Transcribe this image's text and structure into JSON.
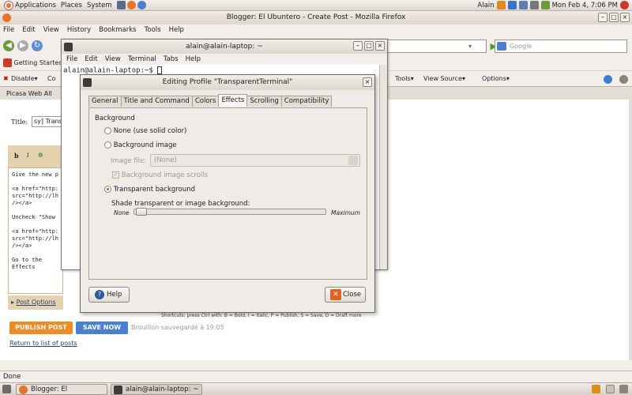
{
  "panel": {
    "applications": "Applications",
    "places": "Places",
    "system": "System",
    "user": "Alain",
    "clock": "Mon Feb  4,  7:06 PM"
  },
  "firefox": {
    "title": "Blogger: El Ubuntero - Create Post - Mozilla Firefox",
    "menu": [
      "File",
      "Edit",
      "View",
      "History",
      "Bookmarks",
      "Tools",
      "Help"
    ],
    "search_placeholder": "Google",
    "bookmark_item": "Getting Started",
    "dev_bar": {
      "disable": "Disable▾",
      "co": "Co",
      "tools": "Tools▾",
      "view_source": "View Source▾",
      "options": "Options▾"
    },
    "tab_label": "Picasa Web All",
    "status": "Done"
  },
  "blogger": {
    "title_label": "Title:",
    "title_value": "sy] Trans",
    "editor_lines": [
      "Give the new p",
      "<a href=\"http:",
      "src=\"http://lh",
      "/></a>",
      "Uncheck \"Show",
      "<a href=\"http:",
      "src=\"http://lh",
      "/></a>",
      "Go to the Effects"
    ],
    "post_options": "Post Options",
    "shortcuts": "Shortcuts: press Ctrl with: B = Bold, I = Italic, P = Publish, S = Save, D = Draft more",
    "publish_label": "PUBLISH POST",
    "save_label": "SAVE NOW",
    "draft_status": "Brouillon sauvegardé à 19:05",
    "return_link": "Return to list of posts"
  },
  "terminal": {
    "title": "alain@alain-laptop: ~",
    "menu": [
      "File",
      "Edit",
      "View",
      "Terminal",
      "Tabs",
      "Help"
    ],
    "prompt": "alain@alain-laptop:~$ "
  },
  "dialog": {
    "title": "Editing Profile \"TransparentTerminal\"",
    "tabs": [
      "General",
      "Title and Command",
      "Colors",
      "Effects",
      "Scrolling",
      "Compatibility"
    ],
    "active_tab": "Effects",
    "section": "Background",
    "opt_none": "None (use solid color)",
    "opt_image": "Background image",
    "image_file_label": "Image file:",
    "image_file_value": "(None)",
    "image_scrolls": "Background image scrolls",
    "opt_transparent": "Transparent background",
    "shade_label": "Shade transparent or image background:",
    "shade_min": "None",
    "shade_max": "Maximum",
    "shade_value": 0,
    "help_label": "Help",
    "close_label": "Close"
  },
  "taskbar": {
    "firefox_task": "Blogger: El Ubuntero...",
    "terminal_task": "alain@alain-laptop: ~"
  },
  "colors": {
    "accent": "#e0621e",
    "publish": "#f08a24",
    "save": "#4a7fd1"
  }
}
